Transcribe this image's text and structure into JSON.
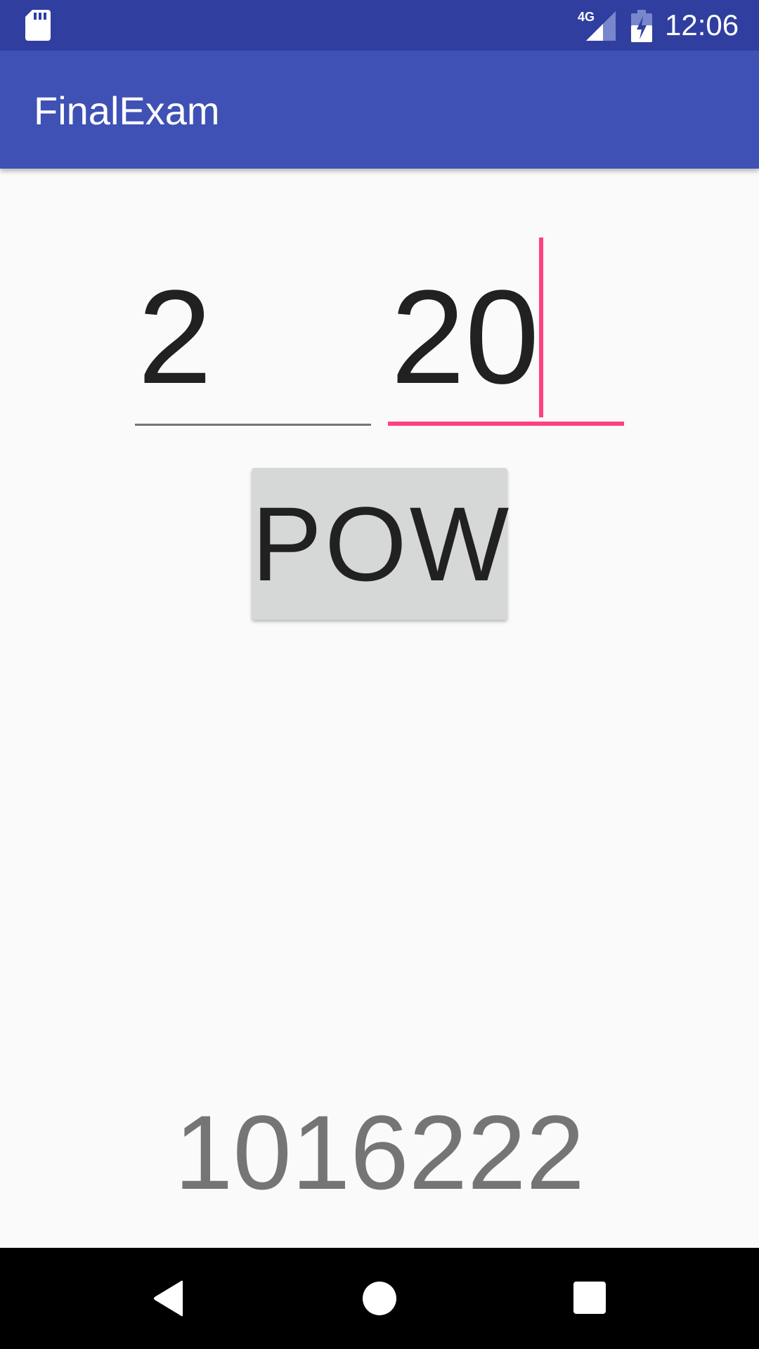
{
  "status_bar": {
    "network": "4G",
    "time": "12:06",
    "icons": [
      "sd-card-icon",
      "signal-icon",
      "battery-charging-icon"
    ]
  },
  "app_bar": {
    "title": "FinalExam"
  },
  "inputs": {
    "base_value": "2",
    "exponent_value": "20"
  },
  "button": {
    "label": "POW"
  },
  "result": {
    "value": "1016222"
  },
  "nav_bar": {
    "icons": [
      "back-icon",
      "home-icon",
      "recents-icon"
    ]
  },
  "colors": {
    "status_bar": "#303f9f",
    "app_bar": "#3f51b5",
    "accent": "#ff4081",
    "background": "#fafafa"
  }
}
